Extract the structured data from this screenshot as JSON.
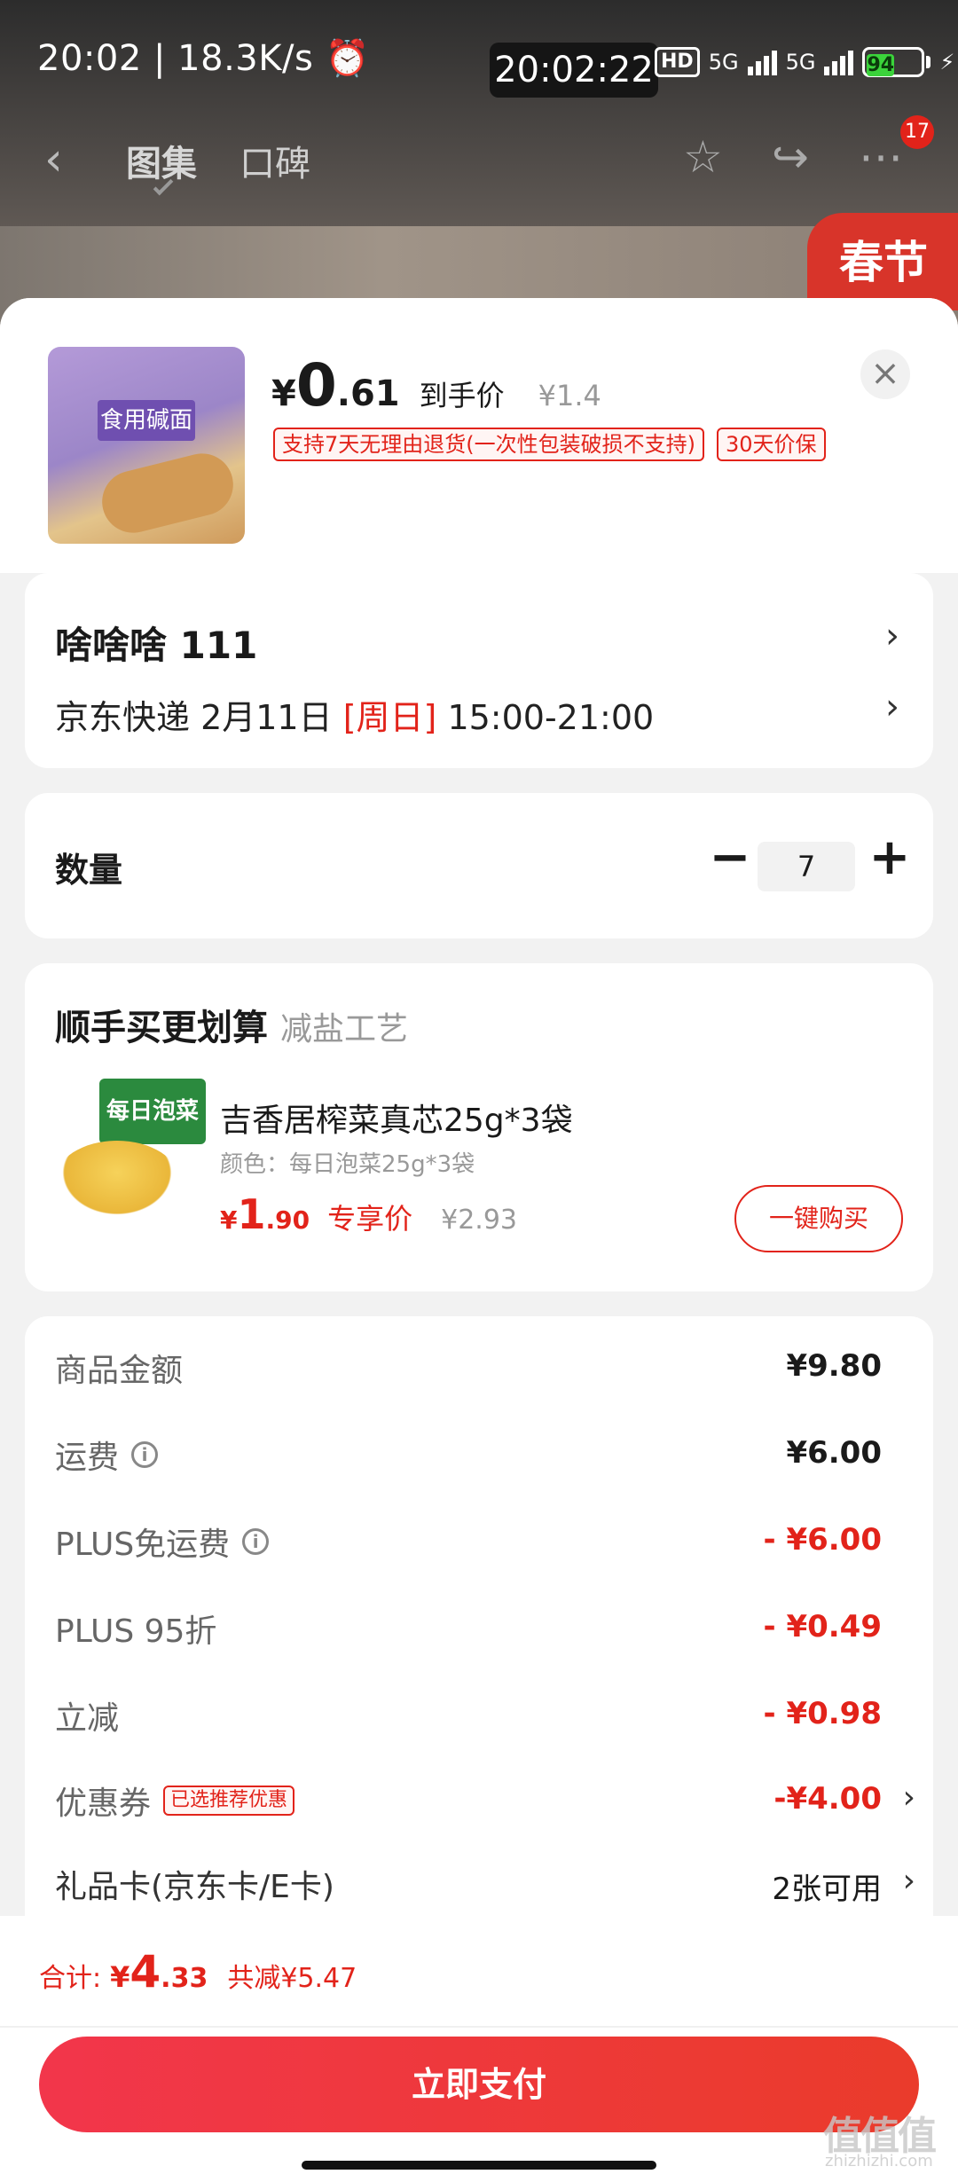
{
  "status_bar": {
    "left_text": "20:02 | 18.3K/s",
    "alarm_icon": "alarm-icon",
    "clock_overlay": "20:02:22",
    "hd_label": "HD",
    "network_1": "5G",
    "network_2": "5G",
    "battery_level": "94"
  },
  "nav": {
    "tabs": [
      {
        "label": "图集"
      },
      {
        "label": "口碑"
      }
    ],
    "badge_count": "17",
    "promo_label": "春节"
  },
  "product": {
    "price_symbol": "¥",
    "price_int": "0",
    "price_dec": ".61",
    "price_label": "到手价",
    "original_price": "¥1.4",
    "thumb_label": "食用碱面",
    "tags": [
      "支持7天无理由退货(一次性包装破损不支持)",
      "30天价保"
    ],
    "close_label": "×"
  },
  "address": {
    "name_line": "啥啥啥  111",
    "delivery_prefix": "京东快递 2月11日 ",
    "delivery_day": "[周日]",
    "delivery_time": " 15:00-21:00",
    "chevron": "›"
  },
  "quantity": {
    "label": "数量",
    "minus": "−",
    "value": "7",
    "plus": "+"
  },
  "upsell": {
    "title": "顺手买更划算",
    "subtitle": "减盐工艺",
    "item": {
      "pack_text": "每日泡菜",
      "name": "吉香居榨菜真芯25g*3袋",
      "spec": "颜色：每日泡菜25g*3袋",
      "price_symbol": "¥",
      "price_int": "1",
      "price_dec": ".90",
      "price_label": "专享价",
      "original_price": "¥2.93",
      "button": "一键购买"
    }
  },
  "summary": {
    "rows": [
      {
        "label": "商品金额",
        "value": "¥9.80"
      },
      {
        "label": "运费",
        "value": "¥6.00"
      },
      {
        "label": "PLUS免运费",
        "value": "- ¥6.00"
      },
      {
        "label": "PLUS 95折",
        "value": "- ¥0.49"
      },
      {
        "label": "立减",
        "value": "- ¥0.98"
      },
      {
        "label": "优惠券",
        "tag": "已选推荐优惠",
        "value": "-¥4.00"
      },
      {
        "label": "礼品卡(京东卡/E卡)",
        "value": "2张可用"
      }
    ]
  },
  "bottom": {
    "total_label": "合计:",
    "total_symbol": "¥",
    "total_int": "4",
    "total_dec": ".33",
    "saved": "共减¥5.47",
    "pay_button": "立即支付"
  },
  "watermark": {
    "text": "值值值",
    "sub": "zhizhizhi.com"
  },
  "colors": {
    "accent_red": "#e2231a",
    "pay_gradient_start": "#f2364b",
    "pay_gradient_end": "#ea3b2b"
  }
}
